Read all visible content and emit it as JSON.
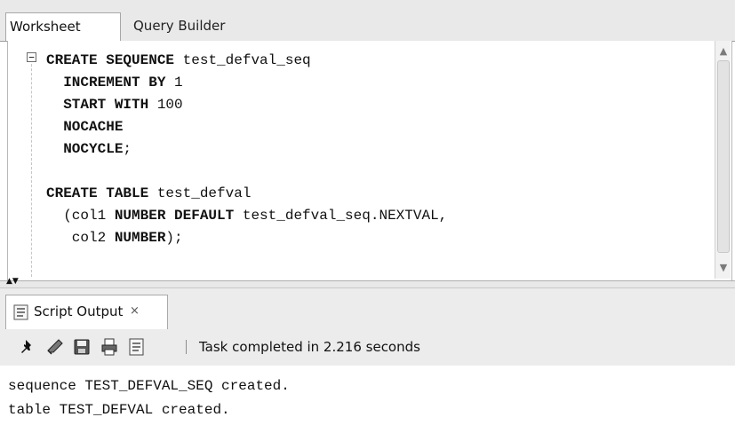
{
  "tabs": [
    {
      "label": "Worksheet"
    },
    {
      "label": "Query Builder"
    }
  ],
  "editor": {
    "lines": [
      [
        {
          "t": "CREATE SEQUENCE",
          "kw": true
        },
        {
          "t": " test_defval_seq"
        }
      ],
      [
        {
          "t": "  INCREMENT BY",
          "kw": true
        },
        {
          "t": " 1"
        }
      ],
      [
        {
          "t": "  START WITH",
          "kw": true
        },
        {
          "t": " 100"
        }
      ],
      [
        {
          "t": "  NOCACHE",
          "kw": true
        }
      ],
      [
        {
          "t": "  NOCYCLE",
          "kw": true
        },
        {
          "t": ";"
        }
      ],
      [
        {
          "t": ""
        }
      ],
      [
        {
          "t": "CREATE TABLE",
          "kw": true
        },
        {
          "t": " test_defval"
        }
      ],
      [
        {
          "t": "  (col1 "
        },
        {
          "t": "NUMBER DEFAULT",
          "kw": true
        },
        {
          "t": " test_defval_seq.NEXTVAL,"
        }
      ],
      [
        {
          "t": "   col2 "
        },
        {
          "t": "NUMBER",
          "kw": true
        },
        {
          "t": ");"
        }
      ]
    ]
  },
  "output_tab": {
    "label": "Script Output",
    "close_glyph": "×",
    "icon": "script-output-icon"
  },
  "toolbar": {
    "icons": [
      "pin-icon",
      "eraser-icon",
      "save-icon",
      "print-icon",
      "script-file-icon"
    ],
    "status": "Task completed in 2.216 seconds"
  },
  "output": {
    "lines": [
      "sequence TEST_DEFVAL_SEQ created.",
      "table TEST_DEFVAL created."
    ]
  }
}
